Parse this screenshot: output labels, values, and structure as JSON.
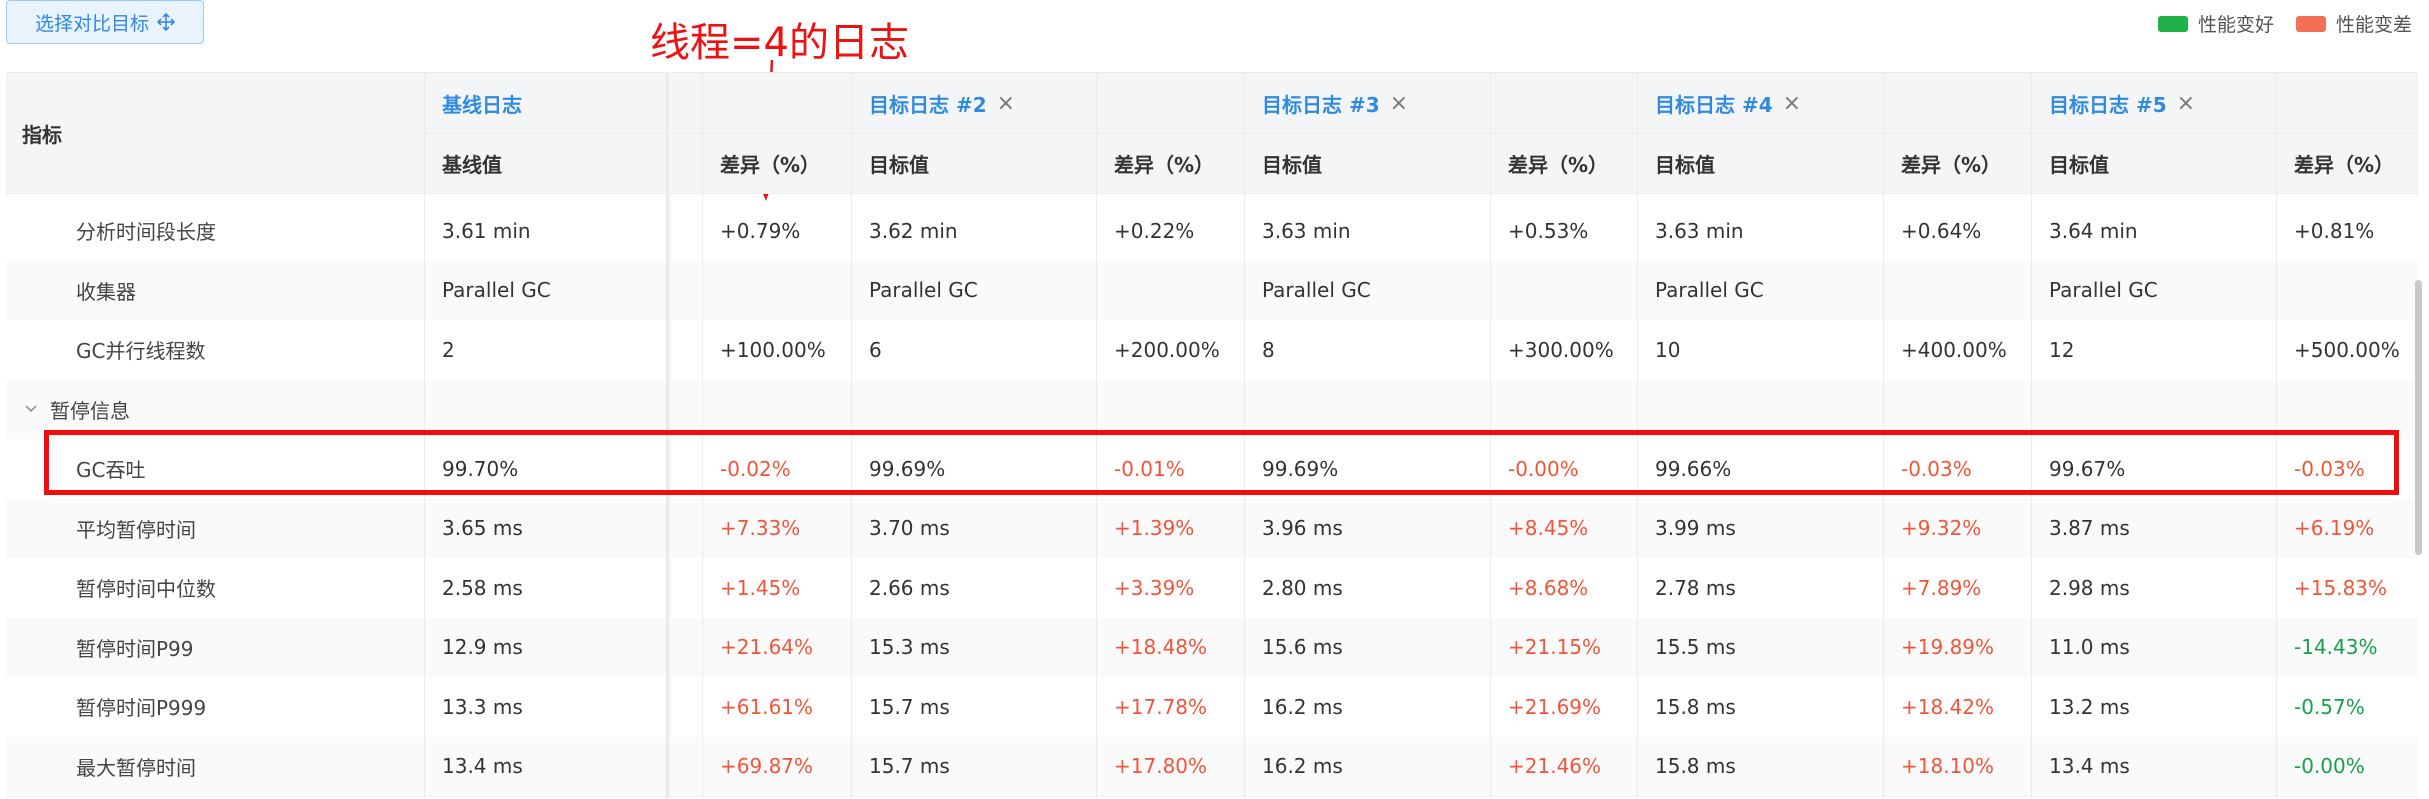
{
  "toolbar": {
    "select_label": "选择对比目标",
    "select_icon": "move-arrows-icon"
  },
  "annotation": {
    "text": "线程=4的日志"
  },
  "legend": [
    {
      "label": "性能变好",
      "color": "#22b04a"
    },
    {
      "label": "性能变差",
      "color": "#f56f54"
    }
  ],
  "table": {
    "metric_header": "指标",
    "groups": [
      {
        "title": "基线日志",
        "closable": false,
        "sub": [
          "基线值",
          "差异（%）"
        ]
      },
      {
        "title": "目标日志 #2",
        "closable": true,
        "sub": [
          "目标值",
          "差异（%）"
        ]
      },
      {
        "title": "目标日志 #3",
        "closable": true,
        "sub": [
          "目标值",
          "差异（%）"
        ]
      },
      {
        "title": "目标日志 #4",
        "closable": true,
        "sub": [
          "目标值",
          "差异（%）"
        ]
      },
      {
        "title": "目标日志 #5",
        "closable": true,
        "sub": [
          "目标值",
          "差异（%）"
        ]
      }
    ],
    "section_label": "暂停信息",
    "rows": [
      {
        "label": "分析时间段长度",
        "cells": [
          "3.61 min",
          "+0.79%",
          "3.62 min",
          "+0.22%",
          "3.63 min",
          "+0.53%",
          "3.63 min",
          "+0.64%",
          "3.64 min",
          "+0.81%"
        ],
        "diff_status": [
          "n",
          "n",
          "n",
          "n",
          "n"
        ]
      },
      {
        "label": "收集器",
        "cells": [
          "Parallel GC",
          "",
          "Parallel GC",
          "",
          "Parallel GC",
          "",
          "Parallel GC",
          "",
          "Parallel GC",
          ""
        ],
        "diff_status": [
          "n",
          "n",
          "n",
          "n",
          "n"
        ]
      },
      {
        "label": "GC并行线程数",
        "cells": [
          "2",
          "+100.00%",
          "6",
          "+200.00%",
          "8",
          "+300.00%",
          "10",
          "+400.00%",
          "12",
          "+500.00%"
        ],
        "diff_status": [
          "n",
          "n",
          "n",
          "n",
          "n"
        ]
      },
      {
        "section": true
      },
      {
        "label": "GC吞吐",
        "cells": [
          "99.70%",
          "-0.02%",
          "99.69%",
          "-0.01%",
          "99.69%",
          "-0.00%",
          "99.66%",
          "-0.03%",
          "99.67%",
          "-0.03%"
        ],
        "diff_status": [
          "bad",
          "bad",
          "bad",
          "bad",
          "bad"
        ]
      },
      {
        "label": "平均暂停时间",
        "cells": [
          "3.65 ms",
          "+7.33%",
          "3.70 ms",
          "+1.39%",
          "3.96 ms",
          "+8.45%",
          "3.99 ms",
          "+9.32%",
          "3.87 ms",
          "+6.19%"
        ],
        "diff_status": [
          "bad",
          "bad",
          "bad",
          "bad",
          "bad"
        ]
      },
      {
        "label": "暂停时间中位数",
        "cells": [
          "2.58 ms",
          "+1.45%",
          "2.66 ms",
          "+3.39%",
          "2.80 ms",
          "+8.68%",
          "2.78 ms",
          "+7.89%",
          "2.98 ms",
          "+15.83%"
        ],
        "diff_status": [
          "bad",
          "bad",
          "bad",
          "bad",
          "bad"
        ]
      },
      {
        "label": "暂停时间P99",
        "cells": [
          "12.9 ms",
          "+21.64%",
          "15.3 ms",
          "+18.48%",
          "15.6 ms",
          "+21.15%",
          "15.5 ms",
          "+19.89%",
          "11.0 ms",
          "-14.43%"
        ],
        "diff_status": [
          "bad",
          "bad",
          "bad",
          "bad",
          "good"
        ]
      },
      {
        "label": "暂停时间P999",
        "cells": [
          "13.3 ms",
          "+61.61%",
          "15.7 ms",
          "+17.78%",
          "16.2 ms",
          "+21.69%",
          "15.8 ms",
          "+18.42%",
          "13.2 ms",
          "-0.57%"
        ],
        "diff_status": [
          "bad",
          "bad",
          "bad",
          "bad",
          "good"
        ]
      },
      {
        "label": "最大暂停时间",
        "cells": [
          "13.4 ms",
          "+69.87%",
          "15.7 ms",
          "+17.80%",
          "16.2 ms",
          "+21.46%",
          "15.8 ms",
          "+18.10%",
          "13.4 ms",
          "-0.00%"
        ],
        "diff_status": [
          "bad",
          "bad",
          "bad",
          "bad",
          "good"
        ]
      }
    ]
  }
}
